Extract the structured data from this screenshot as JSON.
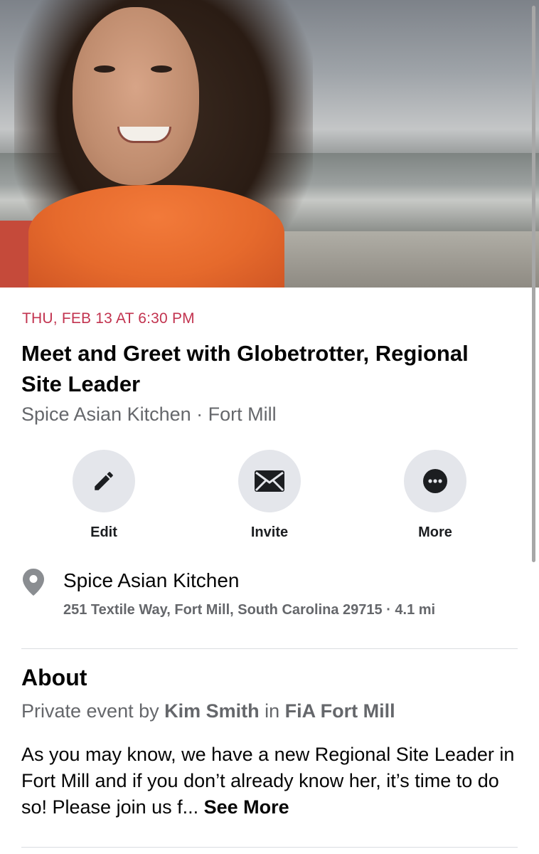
{
  "event": {
    "date": "THU, FEB 13 AT 6:30 PM",
    "title": "Meet and Greet with Globetrotter, Regional Site Leader",
    "subtitle": "Spice Asian Kitchen · Fort Mill"
  },
  "actions": [
    {
      "label": "Edit",
      "icon": "pencil-icon"
    },
    {
      "label": "Invite",
      "icon": "envelope-icon"
    },
    {
      "label": "More",
      "icon": "more-icon"
    }
  ],
  "location": {
    "icon": "location-pin-icon",
    "name": "Spice Asian Kitchen",
    "address": "251 Textile Way, Fort Mill, South Carolina 29715 · 4.1 mi"
  },
  "about": {
    "heading": "About",
    "prefix": "Private event by ",
    "host": "Kim Smith",
    "middle": " in ",
    "group": "FiA Fort Mill",
    "description": "As you may know, we have a new Regional Site Leader in Fort Mill and if you don’t already know her, it’s time to do so! Please join us f... ",
    "see_more": "See More"
  },
  "colors": {
    "date_red": "#c2334f",
    "secondary_text": "#65676b",
    "button_bg": "#e4e6eb"
  }
}
